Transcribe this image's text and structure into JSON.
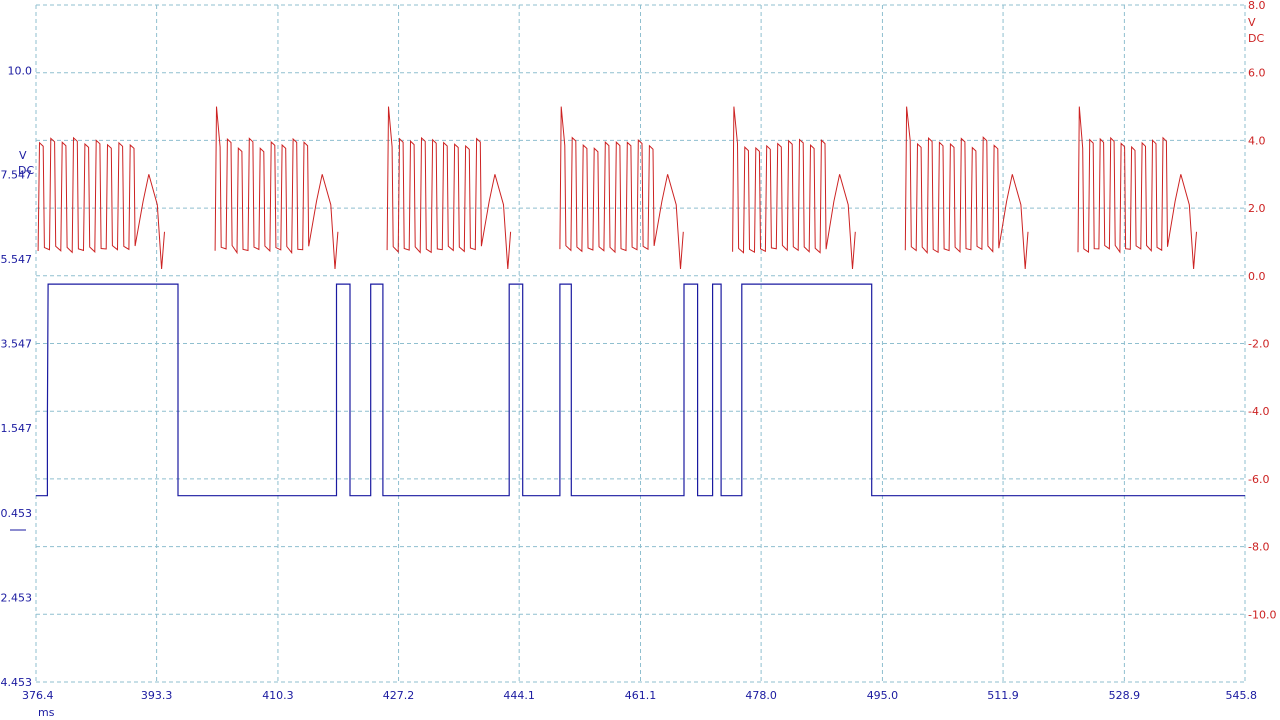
{
  "chart_data": {
    "type": "line",
    "x_axis": {
      "unit": "ms",
      "range": [
        376.4,
        545.8
      ],
      "ticks": [
        "376.4",
        "393.3",
        "410.3",
        "427.2",
        "444.1",
        "461.1",
        "478.0",
        "495.0",
        "511.9",
        "528.9",
        "545.8"
      ]
    },
    "left_axis": {
      "unit_lines": [
        "V",
        "DC"
      ],
      "color": "#1a1aa0",
      "range": [
        -4.453,
        11.547
      ],
      "ticks": [
        "10.0",
        "7.547",
        "5.547",
        "3.547",
        "1.547",
        "-0.453",
        "-2.453",
        "-4.453"
      ],
      "tick_values": [
        10.0,
        7.547,
        5.547,
        3.547,
        1.547,
        -0.453,
        -2.453,
        -4.453
      ]
    },
    "right_axis": {
      "unit_lines": [
        "V",
        "DC"
      ],
      "color": "#cc2222",
      "range": [
        -12.0,
        8.0
      ],
      "ticks": [
        "8.0",
        "6.0",
        "4.0",
        "2.0",
        "0.0",
        "-2.0",
        "-4.0",
        "-6.0",
        "-8.0",
        "-10.0"
      ],
      "tick_values": [
        8.0,
        6.0,
        4.0,
        2.0,
        0.0,
        -2.0,
        -4.0,
        -6.0,
        -8.0,
        -10.0
      ]
    },
    "grid": true,
    "series": [
      {
        "axis": "right",
        "color": "#cc2222",
        "style": "oscillating between about 0.8 V and 4.1 V, with a gap after each burst",
        "high": 4.1,
        "low": 0.8,
        "bursts_ms": [
          [
            376.7,
            391.0
          ],
          [
            401.5,
            415.3
          ],
          [
            425.6,
            439.5
          ],
          [
            449.8,
            463.7
          ],
          [
            474.0,
            487.8
          ],
          [
            498.2,
            512.0
          ],
          [
            522.4,
            535.6
          ]
        ],
        "burst_start_spike": 5.0,
        "burst_end_dip": 0.2
      },
      {
        "axis": "left",
        "color": "#1a1aa0",
        "style": "digital signal",
        "low": -0.05,
        "high": 4.95,
        "steps": [
          [
            376.4,
            -0.05
          ],
          [
            378.0,
            -0.05
          ],
          [
            378.0,
            1.8
          ],
          [
            378.1,
            4.95
          ],
          [
            396.3,
            4.95
          ],
          [
            396.3,
            -0.05
          ],
          [
            418.5,
            -0.05
          ],
          [
            418.5,
            4.95
          ],
          [
            420.4,
            4.95
          ],
          [
            420.4,
            -0.05
          ],
          [
            423.3,
            -0.05
          ],
          [
            423.3,
            4.95
          ],
          [
            425.0,
            4.95
          ],
          [
            425.0,
            -0.05
          ],
          [
            442.7,
            -0.05
          ],
          [
            442.7,
            4.95
          ],
          [
            444.6,
            4.95
          ],
          [
            444.6,
            -0.05
          ],
          [
            449.8,
            -0.05
          ],
          [
            449.8,
            4.95
          ],
          [
            451.4,
            4.95
          ],
          [
            451.4,
            -0.05
          ],
          [
            467.2,
            -0.05
          ],
          [
            467.2,
            4.95
          ],
          [
            469.1,
            4.95
          ],
          [
            469.1,
            -0.05
          ],
          [
            471.2,
            -0.05
          ],
          [
            471.2,
            4.95
          ],
          [
            472.4,
            4.95
          ],
          [
            472.4,
            -0.05
          ],
          [
            475.3,
            -0.05
          ],
          [
            475.3,
            4.95
          ],
          [
            493.5,
            4.95
          ],
          [
            493.5,
            -0.05
          ],
          [
            545.8,
            -0.05
          ]
        ]
      }
    ]
  }
}
